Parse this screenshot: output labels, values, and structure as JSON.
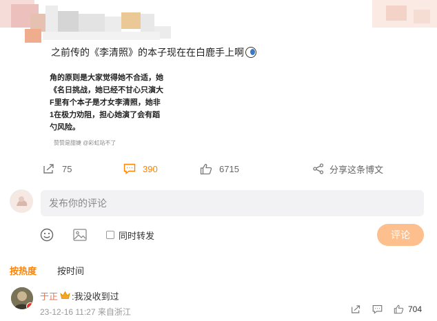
{
  "header_colors": {
    "blur_pink": "#f1c9c5",
    "blur_gray": "#d5d5d5",
    "blur_orange": "#f0ad8e",
    "blur_yellow": "#ebc996"
  },
  "post": {
    "text": "之前传的《李清照》的本子现在在白鹿手上啊",
    "emoji_icon": "thinking-face-icon"
  },
  "image_card": {
    "lines": [
      "角的原则是大家觉得她不合适，她",
      "《名日挑战，她已经不甘心只演大",
      "F里有个本子是才女李清照，她非",
      "1在极力劝阻，担心她演了会有蹈",
      "勺风险。"
    ],
    "caption": "赞赞是甜婕       @彩虹站不了"
  },
  "actions": {
    "repost_count": "75",
    "comment_count": "390",
    "like_count": "6715",
    "share_label": "分享这条博文"
  },
  "composer": {
    "placeholder": "发布你的评论",
    "repost_option": "同时转发",
    "submit_label": "评论"
  },
  "sort_tabs": {
    "hot": "按热度",
    "time": "按时间"
  },
  "comment": {
    "username": "于正",
    "text": ":我没收到过",
    "meta": "23-12-16 11:27 来自浙江",
    "like_count": "704"
  },
  "colors": {
    "accent": "#ff8200",
    "submit_bg": "#fcbf8d",
    "username": "#eb7350"
  }
}
